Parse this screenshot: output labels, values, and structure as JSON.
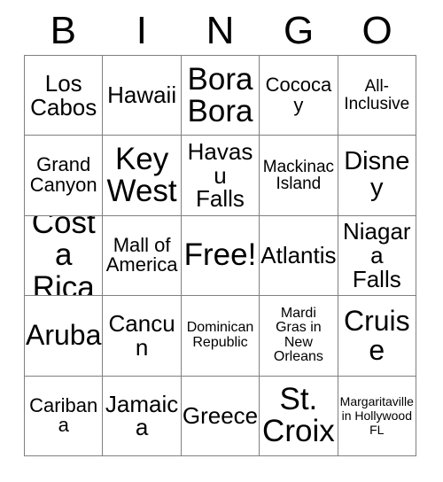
{
  "card": {
    "title": "BINGO",
    "header_letters": [
      "B",
      "I",
      "N",
      "G",
      "O"
    ],
    "free_space_label": "Free!",
    "colors": {
      "background": "#ffffff",
      "text": "#000000",
      "grid_line": "#808080"
    },
    "rows": [
      [
        {
          "label": "Los\nCabos",
          "size": "fs-md"
        },
        {
          "label": "Hawaii",
          "size": "fs-md"
        },
        {
          "label": "Bora\nBora",
          "size": "fs-xxl"
        },
        {
          "label": "Cococay",
          "size": "fs-sm"
        },
        {
          "label": "All-\nInclusive",
          "size": "fs-xs"
        }
      ],
      [
        {
          "label": "Grand\nCanyon",
          "size": "fs-sm"
        },
        {
          "label": "Key\nWest",
          "size": "fs-xxl"
        },
        {
          "label": "Havasu\nFalls",
          "size": "fs-md"
        },
        {
          "label": "Mackinac\nIsland",
          "size": "fs-xs"
        },
        {
          "label": "Disney",
          "size": "fs-lg"
        }
      ],
      [
        {
          "label": "Costa\nRica",
          "size": "fs-xxl"
        },
        {
          "label": "Mall of\nAmerica",
          "size": "fs-sm"
        },
        {
          "label": "Free!",
          "size": "fs-xxl"
        },
        {
          "label": "Atlantis",
          "size": "fs-md"
        },
        {
          "label": "Niagara\nFalls",
          "size": "fs-md"
        }
      ],
      [
        {
          "label": "Aruba",
          "size": "fs-xl"
        },
        {
          "label": "Cancun",
          "size": "fs-md"
        },
        {
          "label": "Dominican\nRepublic",
          "size": "fs-xxs"
        },
        {
          "label": "Mardi\nGras in\nNew\nOrleans",
          "size": "fs-xxs"
        },
        {
          "label": "Cruise",
          "size": "fs-xl"
        }
      ],
      [
        {
          "label": "Caribana",
          "size": "fs-sm"
        },
        {
          "label": "Jamaica",
          "size": "fs-md"
        },
        {
          "label": "Greece",
          "size": "fs-md"
        },
        {
          "label": "St.\nCroix",
          "size": "fs-xxl"
        },
        {
          "label": "Margaritaville\nin Hollywood\nFL",
          "size": "fs-tiny"
        }
      ]
    ]
  }
}
